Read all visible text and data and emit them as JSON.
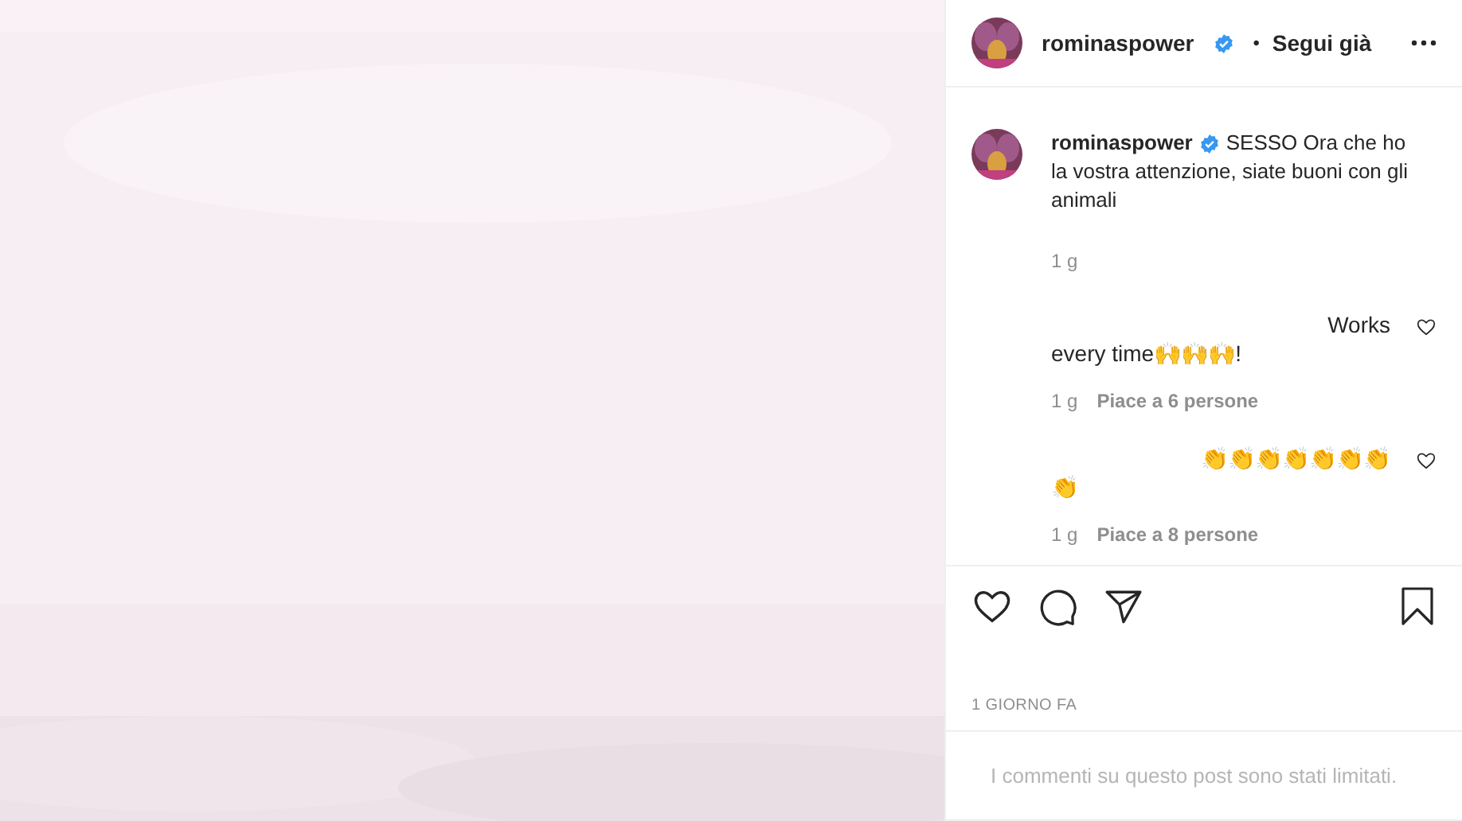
{
  "header": {
    "username": "rominaspower",
    "verified": true,
    "separator": "•",
    "follow_label": "Segui già"
  },
  "caption": {
    "username": "rominaspower",
    "verified": true,
    "text": "SESSO Ora che ho la vostra attenzione, siate buoni con gli animali",
    "time": "1 g"
  },
  "comments": [
    {
      "lines": [
        "Works",
        "every time🙌🙌🙌!"
      ],
      "time": "1 g",
      "likes": "Piace a 6 persone",
      "liked": false
    },
    {
      "lines": [
        "👏👏👏👏👏👏👏",
        "👏"
      ],
      "time": "1 g",
      "likes": "Piace a 8 persone",
      "liked": false
    }
  ],
  "actions": {
    "liked": false,
    "saved": false
  },
  "date": "1 GIORNO FA",
  "footer_note": "I commenti su questo post sono stati limitati."
}
